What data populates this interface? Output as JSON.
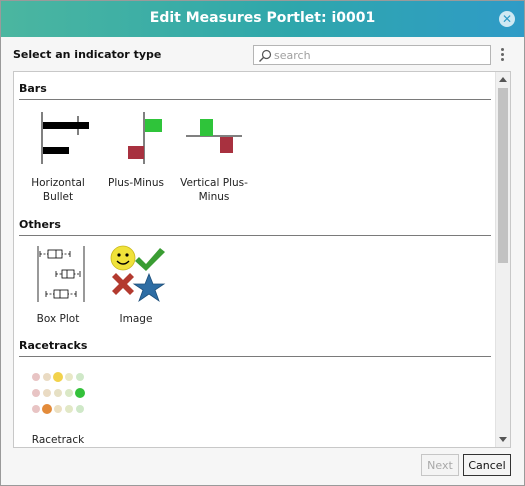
{
  "dialog": {
    "title": "Edit Measures Portlet: i0001",
    "close_glyph": "✕"
  },
  "toolbar": {
    "prompt": "Select an indicator type",
    "search_placeholder": "search",
    "search_value": "",
    "search_icon": "search-icon",
    "menu_icon": "kebab-menu-icon"
  },
  "sections": [
    {
      "title": "Bars",
      "items": [
        {
          "label": "Horizontal Bullet",
          "icon": "horizontal-bullet-icon"
        },
        {
          "label": "Plus-Minus",
          "icon": "plus-minus-icon"
        },
        {
          "label": "Vertical Plus-Minus",
          "icon": "vertical-plus-minus-icon"
        }
      ]
    },
    {
      "title": "Others",
      "items": [
        {
          "label": "Box Plot",
          "icon": "box-plot-icon"
        },
        {
          "label": "Image",
          "icon": "image-icon"
        }
      ]
    },
    {
      "title": "Racetracks",
      "items": [
        {
          "label": "Racetrack",
          "icon": "racetrack-icon"
        }
      ]
    }
  ],
  "footer": {
    "next_label": "Next",
    "next_enabled": false,
    "cancel_label": "Cancel"
  },
  "colors": {
    "title_gradient_start": "#4bb6a0",
    "title_gradient_end": "#2f9bc7",
    "positive": "#2fc43a",
    "negative": "#a8313f",
    "smiley": "#f0e23a",
    "check": "#3a9d33",
    "cross": "#b33a2f",
    "star": "#2e6da4"
  }
}
